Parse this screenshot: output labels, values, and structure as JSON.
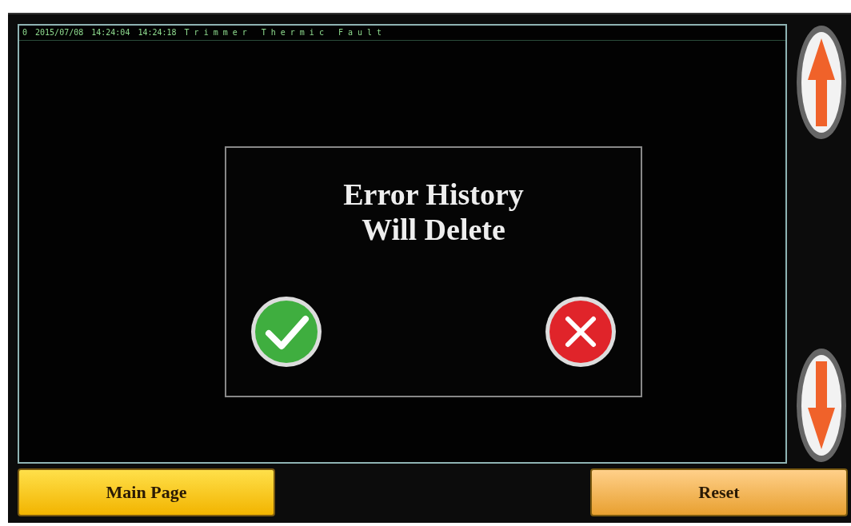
{
  "log_rows": [
    {
      "index": "0",
      "date": "2015/07/08",
      "start": "14:24:04",
      "end": "14:24:18",
      "message": "Trimmer Thermic Fault"
    }
  ],
  "dialog": {
    "message_lines": [
      "Error History",
      "Will Delete"
    ],
    "buttons": [
      {
        "kind": "confirm"
      },
      {
        "kind": "cancel"
      }
    ]
  },
  "scroll_buttons": [
    {
      "kind": "up"
    },
    {
      "kind": "down"
    }
  ],
  "bottom_buttons": [
    "Main Page",
    "Reset"
  ]
}
